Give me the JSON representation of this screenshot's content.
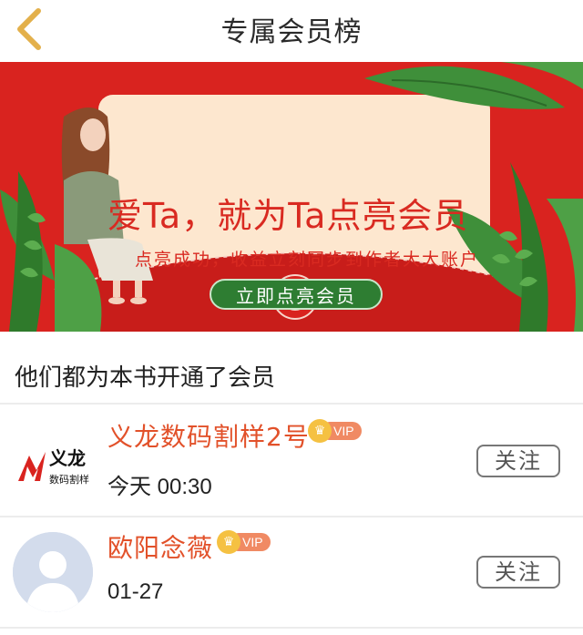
{
  "header": {
    "back_icon": "chevron-left-icon",
    "title": "专属会员榜"
  },
  "banner": {
    "headline": "爱Ta，就为Ta点亮会员",
    "subtitle": "点亮成功，收益立刻同步到作者大大账户",
    "cta_label": "立即点亮会员",
    "colors": {
      "background": "#d9231f",
      "card": "#fde7cf",
      "accent_text": "#d92a21",
      "button": "#2e7d32",
      "leaf": "#3f8f3a"
    }
  },
  "members_section": {
    "title": "他们都为本书开通了会员",
    "follow_label": "关注",
    "vip_label": "VIP",
    "members": [
      {
        "name": "义龙数码割样2号",
        "time": "今天 00:30",
        "avatar": "yilong-logo",
        "avatar_text": "义龙",
        "avatar_subtext": "数码割样"
      },
      {
        "name": "欧阳念薇",
        "time": "01-27",
        "avatar": "default-user-avatar"
      }
    ]
  },
  "colors": {
    "name": "#e2512a",
    "vip_badge": "#f08a63",
    "crown": "#f5c142"
  }
}
